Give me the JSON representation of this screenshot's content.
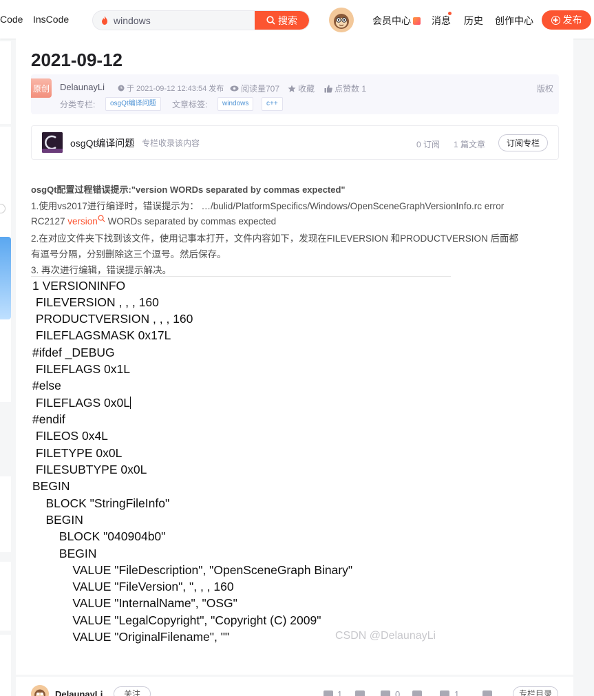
{
  "topbar": {
    "nav_left": [
      "Code",
      "InsCode"
    ],
    "search": {
      "value": "windows",
      "button_label": "搜索"
    },
    "links": {
      "vip": "会员中心",
      "messages": "消息",
      "history": "历史",
      "creator": "创作中心"
    },
    "publish_label": "发布"
  },
  "article": {
    "title": "2021-09-12",
    "badge": "原创",
    "author": "DelaunayLi",
    "published": "于 2021-09-12 12:43:54 发布",
    "views": "阅读量707",
    "favorite": "收藏",
    "likes": "点赞数 1",
    "copyright": "版权",
    "column_label": "分类专栏:",
    "column_tag": "osgQt编译问题",
    "tags_label": "文章标签:",
    "tags": [
      "windows",
      "c++"
    ]
  },
  "column_card": {
    "name": "osgQt编译问题",
    "desc": "专栏收录该内容",
    "subscribers": "0 订阅",
    "articles": "1 篇文章",
    "subscribe_label": "订阅专栏"
  },
  "body": {
    "heading": "osgQt配置过程错误提示:\"version WORDs separated by commas expected\"",
    "line1": "1.使用vs2017进行编译时，错误提示为：  …/bulid/PlatformSpecifics/Windows/OpenSceneGraphVersionInfo.rc error",
    "line2_prefix": "RC2127  ",
    "line2_keyword": "version",
    "line2_suffix": "  WORDs separated by commas expected",
    "line3": "2.在对应文件夹下找到该文件，使用记事本打开，文件内容如下，发现在FILEVERSION 和PRODUCTVERSION 后面都",
    "line4": "有逗号分隔，分别删除这三个逗号。然后保存。",
    "line5": "3. 再次进行编辑，错误提示解决。"
  },
  "code_lines": [
    "1 VERSIONINFO",
    " FILEVERSION , , , 160",
    " PRODUCTVERSION , , , 160",
    " FILEFLAGSMASK 0x17L",
    "#ifdef _DEBUG",
    " FILEFLAGS 0x1L",
    "#else",
    " FILEFLAGS 0x0L",
    "#endif",
    " FILEOS 0x4L",
    " FILETYPE 0x0L",
    " FILESUBTYPE 0x0L",
    "BEGIN",
    "    BLOCK \"StringFileInfo\"",
    "    BEGIN",
    "        BLOCK \"040904b0\"",
    "        BEGIN",
    "            VALUE \"FileDescription\", \"OpenSceneGraph Binary\"",
    "            VALUE \"FileVersion\", \", , , 160",
    "            VALUE \"InternalName\", \"OSG\"",
    "            VALUE \"LegalCopyright\", \"Copyright (C) 2009\"",
    "            VALUE \"OriginalFilename\", \"\""
  ],
  "watermark": "CSDN @DelaunayLi",
  "bottom": {
    "author": "DelaunayLi",
    "follow": "关注",
    "likes": "1",
    "favorites": "0",
    "comments": "1",
    "toc": "专栏目录"
  },
  "colors": {
    "accent": "#fc5531",
    "tag_text": "#5094d5",
    "meta_bg": "#f7f7fc"
  }
}
